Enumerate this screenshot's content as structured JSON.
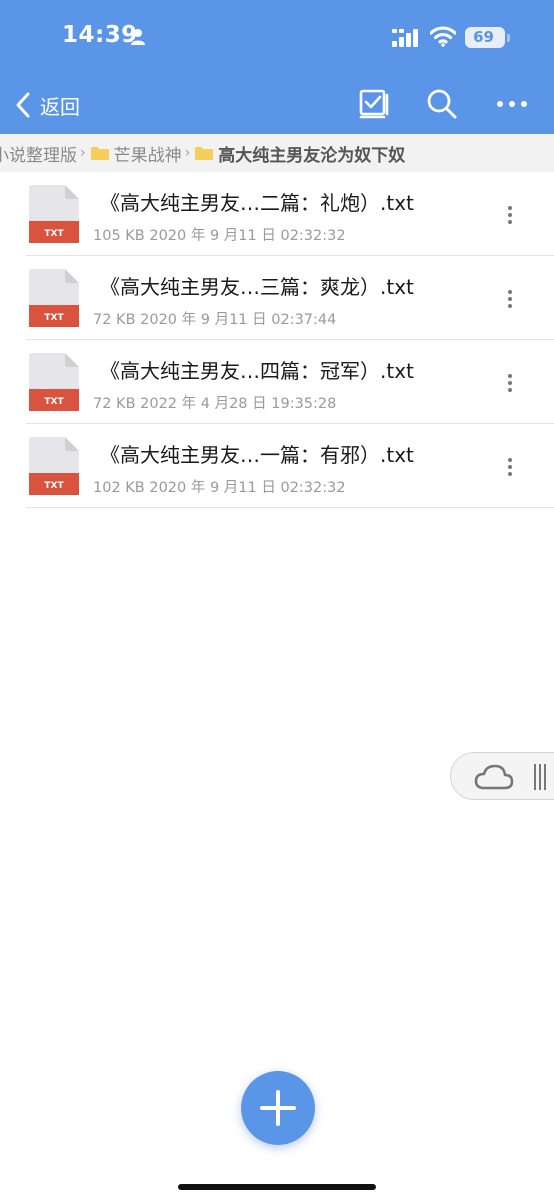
{
  "status_bar": {
    "time": "14:39",
    "battery": "69"
  },
  "nav": {
    "back_label": "返回"
  },
  "breadcrumb": {
    "items": [
      {
        "label": "小说整理版",
        "has_folder_icon": false
      },
      {
        "label": "芒果战神",
        "has_folder_icon": true
      },
      {
        "label": "高大纯主男友沦为奴下奴",
        "has_folder_icon": true
      }
    ]
  },
  "files": [
    {
      "name": "《高大纯主男友…二篇：礼炮）.txt",
      "meta": "105 KB 2020 年 9 月11 日 02:32:32",
      "type_badge": "TXT"
    },
    {
      "name": "《高大纯主男友…三篇：爽龙）.txt",
      "meta": "72 KB 2020 年 9 月11 日 02:37:44",
      "type_badge": "TXT"
    },
    {
      "name": "《高大纯主男友…四篇：冠军）.txt",
      "meta": "72 KB 2022 年 4 月28 日 19:35:28",
      "type_badge": "TXT"
    },
    {
      "name": "《高大纯主男友…一篇：有邪）.txt",
      "meta": "102 KB 2020 年 9 月11 日 02:32:32",
      "type_badge": "TXT"
    }
  ],
  "colors": {
    "header_blue": "#5b95e8",
    "txt_badge_red": "#d9533f",
    "folder_yellow": "#f5cf5a"
  },
  "icons": {
    "nav": [
      "back-chevron-icon",
      "multi-select-icon",
      "search-icon",
      "more-icon"
    ],
    "fab": "plus-icon",
    "floating": [
      "cloud-icon",
      "grip-icon"
    ]
  }
}
